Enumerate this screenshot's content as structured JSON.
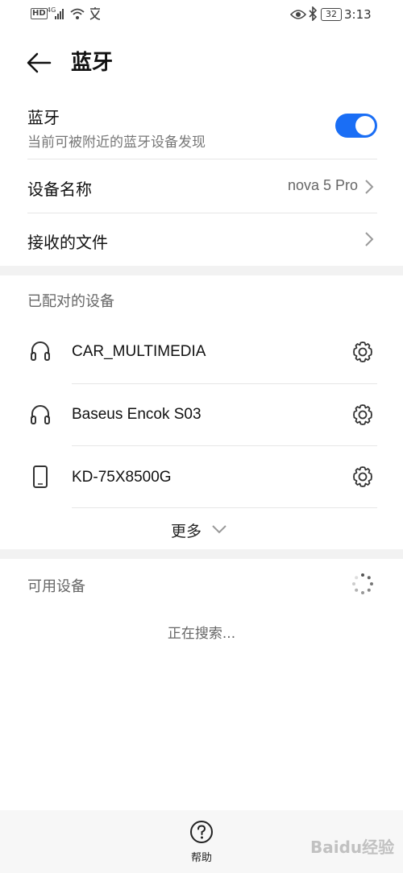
{
  "status_bar": {
    "left_icons": [
      "hd-icon",
      "4g-signal-icon",
      "wifi-icon",
      "translate-icon"
    ],
    "hd": "HD",
    "network": "4G",
    "battery": "32",
    "time": "3:13"
  },
  "header": {
    "title": "蓝牙"
  },
  "bluetooth": {
    "label": "蓝牙",
    "subtitle": "当前可被附近的蓝牙设备发现",
    "enabled": true,
    "accent": "#1a6ef5"
  },
  "device_name": {
    "label": "设备名称",
    "value": "nova 5 Pro"
  },
  "received_files": {
    "label": "接收的文件"
  },
  "paired": {
    "section_label": "已配对的设备",
    "devices": [
      {
        "name": "CAR_MULTIMEDIA",
        "icon": "headset-icon"
      },
      {
        "name": "Baseus Encok S03",
        "icon": "headset-icon"
      },
      {
        "name": "KD-75X8500G",
        "icon": "phone-icon"
      }
    ],
    "more_label": "更多"
  },
  "available": {
    "section_label": "可用设备",
    "searching_text": "正在搜索..."
  },
  "footer": {
    "help_label": "帮助"
  },
  "watermark": "Baidu经验"
}
